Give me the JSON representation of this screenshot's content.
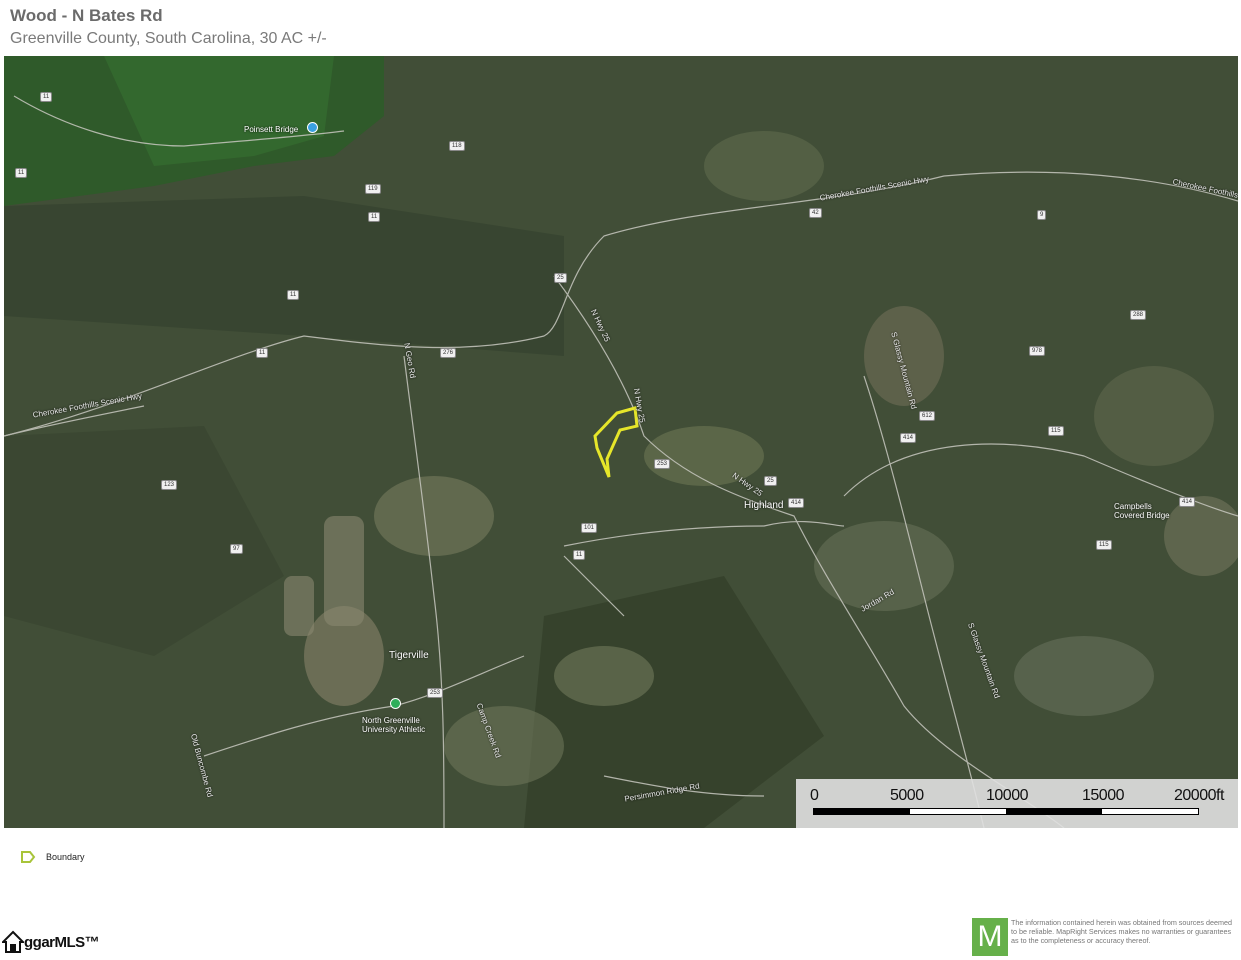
{
  "header": {
    "title": "Wood - N Bates Rd",
    "subtitle": "Greenville County, South Carolina, 30 AC +/-"
  },
  "map": {
    "type": "satellite",
    "boundary_color": "#e6e62a",
    "places": [
      {
        "id": "poinsett",
        "label": "Poinsett Bridge",
        "marker_color": "#3aa0e0"
      },
      {
        "id": "highland",
        "label": "Highland"
      },
      {
        "id": "campbells",
        "label": "Campbells Covered Bridge"
      },
      {
        "id": "tigerville",
        "label": "Tigerville"
      },
      {
        "id": "ngu",
        "label": "North Greenville University Athletic",
        "marker_color": "#2fae5a"
      }
    ],
    "road_labels": {
      "cherokee1": "Cherokee Foothills Scenic Hwy",
      "cherokee2": "Cherokee Foothills Scenic Hwy",
      "cherokee3": "Cherokee Foothills",
      "nhwy25a": "N Hwy 25",
      "nhwy25b": "N Hwy 25",
      "nhwy25c": "N Hwy 25",
      "ngeorgia": "N Geo Rd",
      "sgoodjunior": "S Glassy Mountain Rd",
      "jordan": "Jordan Rd",
      "campcreek": "Camp Creek Rd",
      "oldbuncombe": "Old Buncombe Rd",
      "sgoodmtn": "S Glassy Mountain Rd",
      "persimmon": "Persimmon Ridge Rd"
    },
    "route_shields": [
      "11",
      "11",
      "11",
      "11",
      "276",
      "25",
      "414",
      "253",
      "414",
      "101",
      "11",
      "25",
      "115",
      "414",
      "115",
      "118",
      "119",
      "11",
      "253",
      "42",
      "123",
      "97",
      "978",
      "612",
      "288",
      "9"
    ]
  },
  "scale": {
    "labels": [
      "0",
      "5000",
      "10000",
      "15000",
      "20000ft"
    ]
  },
  "legend": {
    "items": [
      {
        "label": "Boundary",
        "color": "#c8d84a"
      }
    ]
  },
  "footer": {
    "left_logo_text": "ggarMLS™",
    "right_logo_letter": "M",
    "disclaimer": "The information contained herein was obtained from sources deemed to be reliable. MapRight Services makes no warranties or guarantees as to the completeness or accuracy thereof."
  }
}
